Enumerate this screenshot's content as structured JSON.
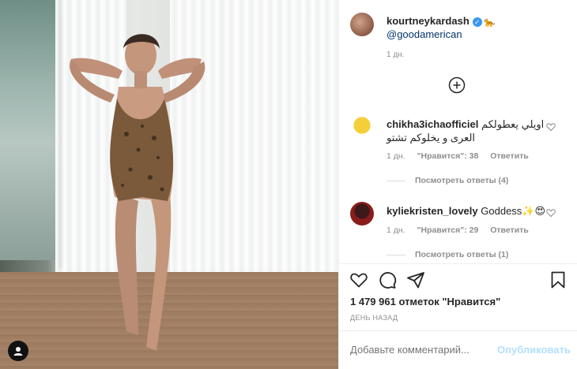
{
  "post": {
    "username": "kourtneykardash",
    "mention": "@goodamerican",
    "time": "1 дн.",
    "emoji": "🐆"
  },
  "comments": [
    {
      "username": "chikha3ichaofficiel",
      "text": "اويلي يعطولكم العرى و يخلوكم تشتو",
      "time": "1 дн.",
      "likes": "\"Нравится\": 38",
      "reply": "Ответить",
      "view_replies": "Посмотреть ответы (4)"
    },
    {
      "username": "kyliekristen_lovely",
      "text": "Goddess✨😍",
      "time": "1 дн.",
      "likes": "\"Нравится\": 29",
      "reply": "Ответить",
      "view_replies": "Посмотреть ответы (1)"
    }
  ],
  "likes_count": "1 479 961 отметок \"Нравится\"",
  "ago": "ДЕНЬ НАЗАД",
  "comment_input": {
    "placeholder": "Добавьте комментарий..."
  },
  "publish_label": "Опубликовать",
  "colors": {
    "link": "#003569",
    "verified": "#3897f0",
    "publish_disabled": "#b2dffc",
    "muted": "#8e8e8e"
  },
  "icons": [
    "verified-badge-icon",
    "plus-circle-icon",
    "heart-icon",
    "comment-icon",
    "share-icon",
    "bookmark-icon",
    "user-icon"
  ]
}
